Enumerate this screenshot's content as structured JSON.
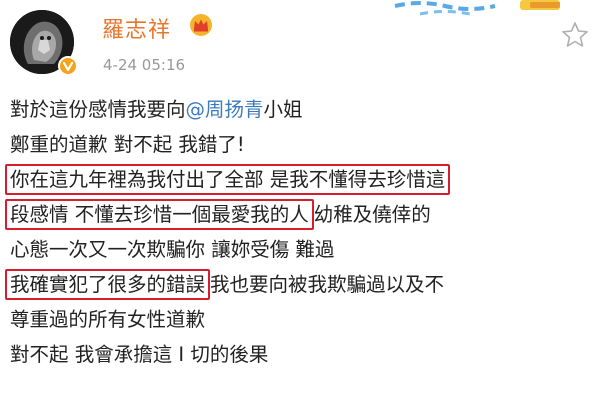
{
  "post": {
    "username": "羅志祥",
    "timestamp": "4-24 05:16",
    "lines": [
      {
        "parts": [
          "對於這份感情我要向 ",
          "@周扬青",
          " 小姐"
        ]
      },
      {
        "parts": [
          "鄭重的道歉 對不起 我錯了!"
        ]
      },
      {
        "parts": [
          "你在這九年裡為我付出了全部 是我不懂得去珍惜這"
        ]
      },
      {
        "parts": [
          "段感情 不懂去珍惜一個最愛我的人",
          " 幼稚及僥倖的"
        ]
      },
      {
        "parts": [
          "心態一次又一次欺騙你 讓妳受傷 難過"
        ]
      },
      {
        "parts": [
          "我確實犯了很多的錯誤",
          " 我也要向被我欺騙過以及不"
        ]
      },
      {
        "parts": [
          "尊重過的所有女性道歉"
        ]
      },
      {
        "parts": [
          "對不起  我會承擔這 I 切的後果"
        ]
      }
    ]
  },
  "colors": {
    "username": "#e8772e",
    "mention": "#3d7bbf",
    "highlight_box": "#d81e2c",
    "timestamp": "#999999"
  },
  "icons": {
    "verified": "verified-badge-icon",
    "member": "crown-icon",
    "favorite": "star-outline-icon"
  }
}
